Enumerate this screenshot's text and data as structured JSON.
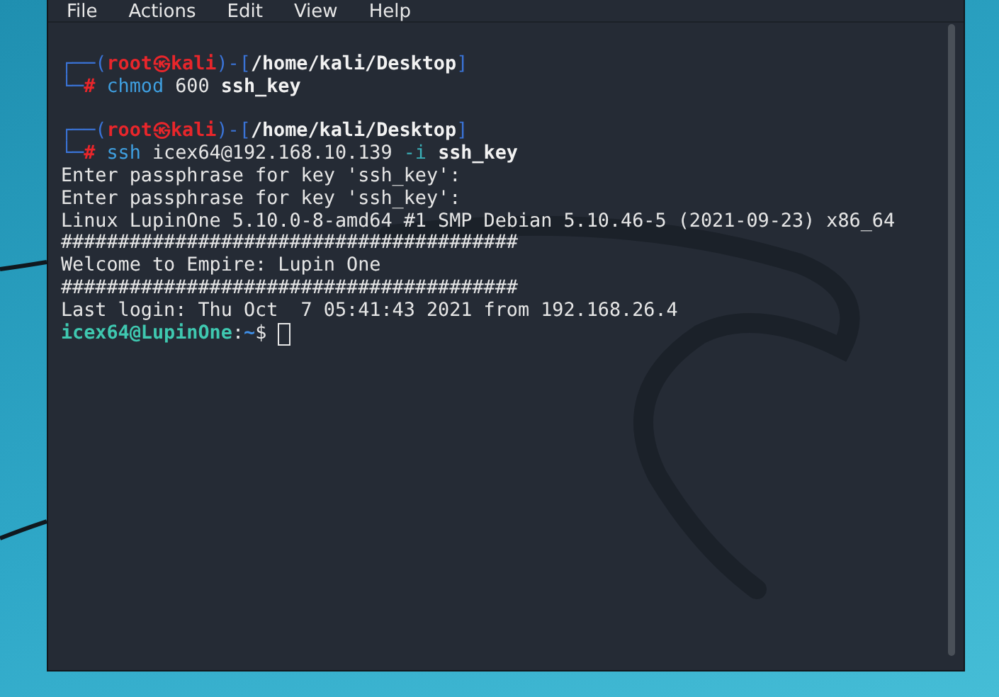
{
  "window": {
    "menu": [
      "File",
      "Actions",
      "Edit",
      "View",
      "Help"
    ]
  },
  "terminal": {
    "lines": [
      {
        "kind": "prompt",
        "frame": "┌──(",
        "user": "root",
        "at": "㉿",
        "host": "kali",
        "sep": ")-[",
        "path": "/home/kali/Desktop",
        "close": "]"
      },
      {
        "kind": "command",
        "frame": "└─",
        "symbol": "#",
        "tokens": [
          {
            "text": "chmod",
            "kind": "command"
          },
          {
            "text": "600",
            "kind": "plain"
          },
          {
            "text": "ssh_key",
            "kind": "bold"
          }
        ]
      },
      {
        "kind": "prompt",
        "frame": "┌──(",
        "user": "root",
        "at": "㉿",
        "host": "kali",
        "sep": ")-[",
        "path": "/home/kali/Desktop",
        "close": "]"
      },
      {
        "kind": "command",
        "frame": "└─",
        "symbol": "#",
        "tokens": [
          {
            "text": "ssh",
            "kind": "command"
          },
          {
            "text": "icex64@192.168.10.139",
            "kind": "plain"
          },
          {
            "text": "-i",
            "kind": "option"
          },
          {
            "text": "ssh_key",
            "kind": "bold"
          }
        ]
      },
      {
        "kind": "output",
        "text": "Enter passphrase for key 'ssh_key':"
      },
      {
        "kind": "output",
        "text": "Enter passphrase for key 'ssh_key':"
      },
      {
        "kind": "output",
        "text": "Linux LupinOne 5.10.0-8-amd64 #1 SMP Debian 5.10.46-5 (2021-09-23) x86_64"
      },
      {
        "kind": "output",
        "text": "########################################"
      },
      {
        "kind": "output",
        "text": "Welcome to Empire: Lupin One"
      },
      {
        "kind": "output",
        "text": "########################################"
      },
      {
        "kind": "output",
        "text": "Last login: Thu Oct  7 05:41:43 2021 from 192.168.26.4"
      },
      {
        "kind": "shell",
        "user_host": "icex64@LupinOne",
        "sep": ":",
        "path": "~",
        "symbol": "$",
        "cursor": true
      }
    ]
  }
}
